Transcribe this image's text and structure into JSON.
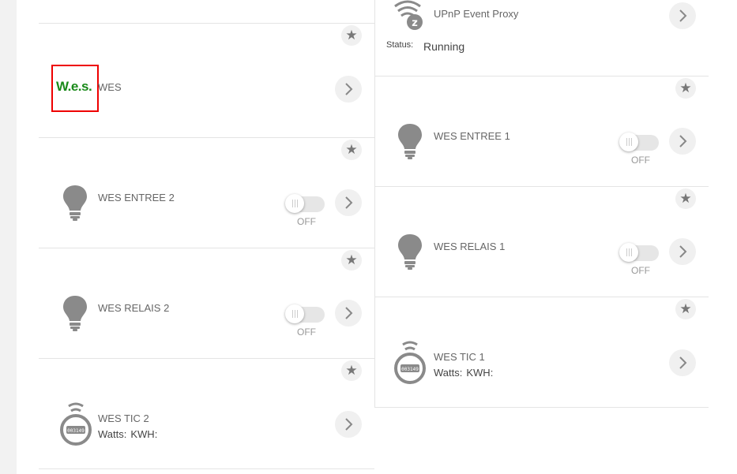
{
  "devices_left": [
    {
      "name": "WES"
    },
    {
      "name": "WES ENTREE 2",
      "toggle": "OFF"
    },
    {
      "name": "WES RELAIS 2",
      "toggle": "OFF"
    },
    {
      "name": "WES TIC 2",
      "watts_label": "Watts:",
      "kwh_label": "KWH:"
    }
  ],
  "devices_right": [
    {
      "name": "UPnP Event Proxy",
      "status_label": "Status:",
      "status_value": "Running"
    },
    {
      "name": "WES ENTREE 1",
      "toggle": "OFF"
    },
    {
      "name": "WES RELAIS 1",
      "toggle": "OFF"
    },
    {
      "name": "WES TIC 1",
      "watts_label": "Watts:",
      "kwh_label": "KWH:"
    }
  ],
  "logo": {
    "text": "W.e.s.",
    "text_color": "#1a8a1a",
    "border_color": "#e00000"
  },
  "icons": {
    "favorite": "star-icon",
    "details": "chevron-right-icon",
    "light": "light-bulb-icon",
    "meter": "energy-meter-icon",
    "proxy": "upnp-proxy-icon",
    "meter_display": "003149"
  },
  "glyphs": {
    "star": "★"
  }
}
